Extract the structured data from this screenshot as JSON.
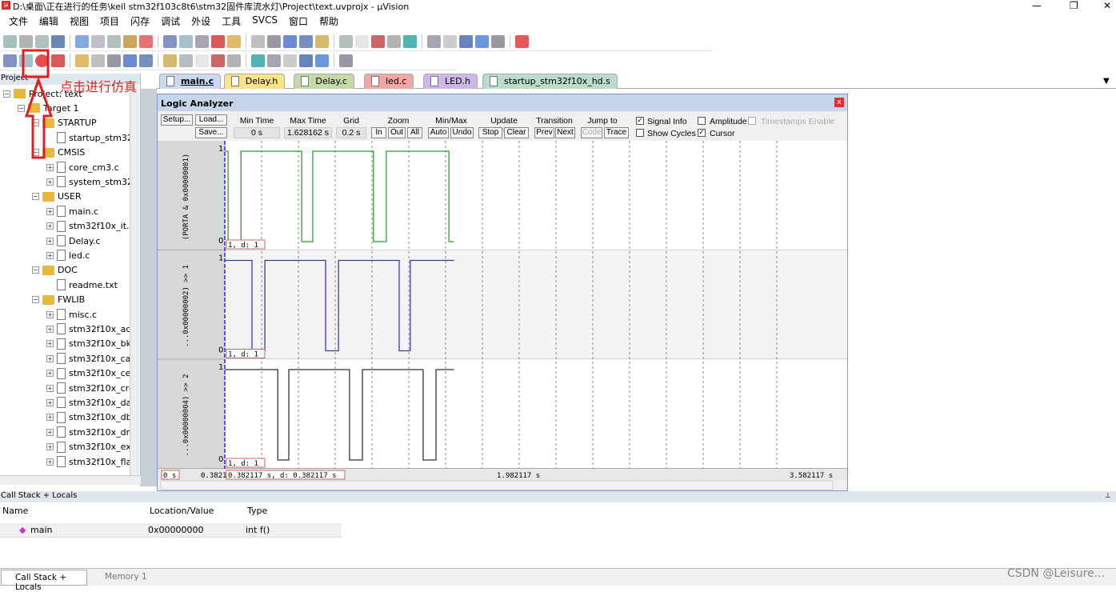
{
  "window": {
    "title": "D:\\桌面\\正在进行的任务\\keil stm32f103c8t6\\stm32固件库流水灯\\Project\\text.uvprojx - µVision",
    "minimize": "—",
    "maximize": "❐",
    "close": "✕"
  },
  "menu": [
    "文件",
    "编辑",
    "视图",
    "项目",
    "闪存",
    "调试",
    "外设",
    "工具",
    "SVCS",
    "窗口",
    "帮助"
  ],
  "toolbar1": [
    "new-file",
    "open",
    "save",
    "save-all",
    "cut",
    "copy",
    "paste",
    "undo",
    "redo",
    "nav-back",
    "nav-forward",
    "bookmark",
    "bookmark-prev",
    "bookmark-next",
    "bookmark-clear",
    "indent",
    "unindent",
    "comment",
    "uncomment",
    "find-in-files",
    "dropdown",
    "find",
    "config-wizard",
    "debug-session",
    "breakpoint-insert",
    "breakpoint-disable",
    "breakpoint-disable-all",
    "breakpoint-kill-all",
    "window-layout",
    "tools"
  ],
  "toolbar2": [
    "reset",
    "start-stop-debug",
    "stop",
    "step-into",
    "step-over",
    "step-out",
    "run-to-cursor",
    "show-next-statement",
    "command-window",
    "disassembly-window",
    "symbols-window",
    "registers-window",
    "call-stack-window",
    "watch-window",
    "memory-window",
    "serial-window",
    "analysis-window",
    "trace-window",
    "system-viewer",
    "toolbox"
  ],
  "project": {
    "header": "Project",
    "tree": [
      {
        "label": "Project: text",
        "level": 0,
        "type": "root"
      },
      {
        "label": "Target 1",
        "level": 1,
        "type": "folder"
      },
      {
        "label": "STARTUP",
        "level": 2,
        "type": "folder"
      },
      {
        "label": "startup_stm32",
        "level": 3,
        "type": "file"
      },
      {
        "label": "CMSIS",
        "level": 2,
        "type": "folder"
      },
      {
        "label": "core_cm3.c",
        "level": 3,
        "type": "file"
      },
      {
        "label": "system_stm32",
        "level": 3,
        "type": "file"
      },
      {
        "label": "USER",
        "level": 2,
        "type": "folder"
      },
      {
        "label": "main.c",
        "level": 3,
        "type": "file"
      },
      {
        "label": "stm32f10x_it.c",
        "level": 3,
        "type": "file"
      },
      {
        "label": "Delay.c",
        "level": 3,
        "type": "file"
      },
      {
        "label": "led.c",
        "level": 3,
        "type": "file"
      },
      {
        "label": "DOC",
        "level": 2,
        "type": "folder"
      },
      {
        "label": "readme.txt",
        "level": 3,
        "type": "file"
      },
      {
        "label": "FWLIB",
        "level": 2,
        "type": "folder"
      },
      {
        "label": "misc.c",
        "level": 3,
        "type": "file"
      },
      {
        "label": "stm32f10x_ad",
        "level": 3,
        "type": "file"
      },
      {
        "label": "stm32f10x_bk",
        "level": 3,
        "type": "file"
      },
      {
        "label": "stm32f10x_ca",
        "level": 3,
        "type": "file"
      },
      {
        "label": "stm32f10x_ce",
        "level": 3,
        "type": "file"
      },
      {
        "label": "stm32f10x_crc",
        "level": 3,
        "type": "file"
      },
      {
        "label": "stm32f10x_da",
        "level": 3,
        "type": "file"
      },
      {
        "label": "stm32f10x_db",
        "level": 3,
        "type": "file"
      },
      {
        "label": "stm32f10x_dm",
        "level": 3,
        "type": "file"
      },
      {
        "label": "stm32f10x_ex",
        "level": 3,
        "type": "file"
      },
      {
        "label": "stm32f10x_fla",
        "level": 3,
        "type": "file"
      }
    ]
  },
  "tabs": [
    {
      "label": "main.c",
      "color": "#c9d9f0",
      "active": true
    },
    {
      "label": "Delay.h",
      "color": "#fbe38a"
    },
    {
      "label": "Delay.c",
      "color": "#c6d7a8"
    },
    {
      "label": "led.c",
      "color": "#f2a6a6"
    },
    {
      "label": "LED.h",
      "color": "#cdb7e8"
    },
    {
      "label": "startup_stm32f10x_hd.s",
      "color": "#b9dccd"
    }
  ],
  "annotation": {
    "text": "点击进行仿真",
    "color": "#e21f1f"
  },
  "logic_analyzer": {
    "title": "Logic Analyzer",
    "close": "x",
    "setup": "Setup...",
    "load": "Load...",
    "save": "Save...",
    "min_time_label": "Min Time",
    "min_time": "0 s",
    "max_time_label": "Max Time",
    "max_time": "1.628162 s",
    "grid_label": "Grid",
    "grid": "0.2 s",
    "zoom_label": "Zoom",
    "zoom_in": "In",
    "zoom_out": "Out",
    "zoom_all": "All",
    "minmax_label": "Min/Max",
    "auto": "Auto",
    "undo": "Undo",
    "update_label": "Update Screen",
    "stop": "Stop",
    "clear": "Clear",
    "transition_label": "Transition",
    "prev": "Prev",
    "next": "Next",
    "jump_label": "Jump to",
    "code": "Code",
    "trace": "Trace",
    "signal_info": {
      "label": "Signal Info",
      "checked": true
    },
    "amplitude": {
      "label": "Amplitude",
      "checked": false
    },
    "timestamps": {
      "label": "Timestamps Enable",
      "checked": false
    },
    "show_cycles": {
      "label": "Show Cycles",
      "checked": false
    },
    "cursor": {
      "label": "Cursor",
      "checked": true
    },
    "axis": {
      "left": "0 s",
      "start": "0.3821",
      "cursor": "0.382117 s,   d: 0.382117 s",
      "mid": "1.982117 s",
      "right": "3.582117 s"
    }
  },
  "chart_data": {
    "type": "line",
    "xlabel": "",
    "ylabel": "",
    "x_range_s": [
      0.382117,
      3.582117
    ],
    "grid_s": 0.2,
    "series": [
      {
        "name": "(PORTA & 0x00000001)",
        "color": "#2ca02c",
        "cursor_label": "1,    d: 1",
        "steps": [
          [
            0.382,
            1
          ],
          [
            0.4,
            0
          ],
          [
            0.47,
            1
          ],
          [
            0.8,
            0
          ],
          [
            0.86,
            1
          ],
          [
            1.19,
            0
          ],
          [
            1.26,
            1
          ],
          [
            1.6,
            0
          ],
          [
            1.628,
            0
          ]
        ]
      },
      {
        "name": "...0x00000002) >> 1",
        "color": "#3a3aa8",
        "cursor_label": "1,    d: 1",
        "steps": [
          [
            0.382,
            1
          ],
          [
            0.53,
            0
          ],
          [
            0.6,
            1
          ],
          [
            0.93,
            0
          ],
          [
            1.0,
            1
          ],
          [
            1.33,
            0
          ],
          [
            1.39,
            1
          ],
          [
            1.628,
            1
          ]
        ]
      },
      {
        "name": "...0x00000004) >> 2",
        "color": "#333333",
        "cursor_label": "1,    d: 1",
        "steps": [
          [
            0.382,
            1
          ],
          [
            0.67,
            0
          ],
          [
            0.73,
            1
          ],
          [
            1.06,
            0
          ],
          [
            1.13,
            1
          ],
          [
            1.46,
            0
          ],
          [
            1.53,
            1
          ],
          [
            1.628,
            1
          ]
        ]
      }
    ]
  },
  "callstack": {
    "header": "Call Stack + Locals",
    "cols": [
      "Name",
      "Location/Value",
      "Type"
    ],
    "rows": [
      {
        "name": "main",
        "value": "0x00000000",
        "type": "int f()"
      }
    ]
  },
  "bottom_tabs": [
    "Call Stack + Locals",
    "Memory 1"
  ],
  "watermark": "CSDN @Leisure..."
}
